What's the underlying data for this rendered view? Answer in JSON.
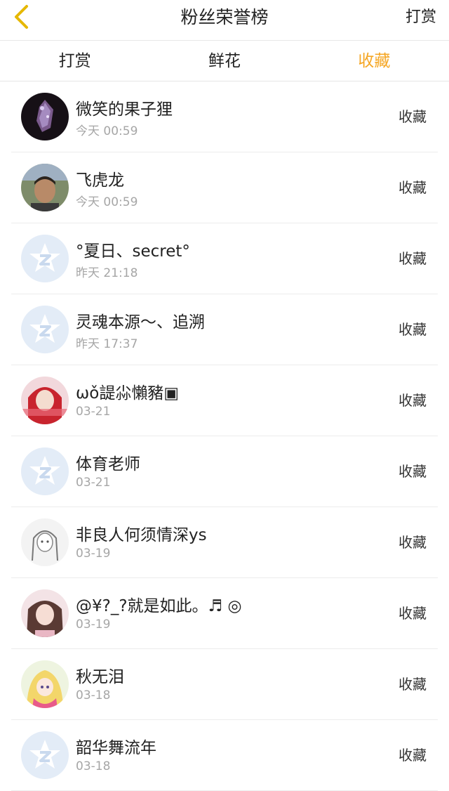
{
  "header": {
    "title": "粉丝荣誉榜",
    "action_label": "打赏"
  },
  "tabs": [
    {
      "label": "打赏"
    },
    {
      "label": "鲜花"
    },
    {
      "label": "收藏"
    }
  ],
  "active_tab_color": "#f5a623",
  "back_icon_color": "#e6b800",
  "rows": [
    {
      "name": "微笑的果子狸",
      "time": "今天 00:59",
      "action": "收藏",
      "avatar": "crystal-photo"
    },
    {
      "name": "飞虎龙",
      "time": "今天 00:59",
      "action": "收藏",
      "avatar": "man-photo"
    },
    {
      "name": "°夏日、secret°",
      "time": "昨天 21:18",
      "action": "收藏",
      "avatar": "default-star"
    },
    {
      "name": "灵魂本源～、追溯",
      "time": "昨天 17:37",
      "action": "收藏",
      "avatar": "default-star"
    },
    {
      "name": "ωǒ諟尛懶豬▣",
      "time": "03-21",
      "action": "收藏",
      "avatar": "red-hair-photo"
    },
    {
      "name": "体育老师",
      "time": "03-21",
      "action": "收藏",
      "avatar": "default-star"
    },
    {
      "name": "非良人何须情深ys",
      "time": "03-19",
      "action": "收藏",
      "avatar": "sketch-photo"
    },
    {
      "name": "@¥?_?就是如此。♬ ◎",
      "time": "03-19",
      "action": "收藏",
      "avatar": "girl-photo"
    },
    {
      "name": "秋无泪",
      "time": "03-18",
      "action": "收藏",
      "avatar": "anime-photo"
    },
    {
      "name": "韶华舞流年",
      "time": "03-18",
      "action": "收藏",
      "avatar": "default-star"
    }
  ]
}
